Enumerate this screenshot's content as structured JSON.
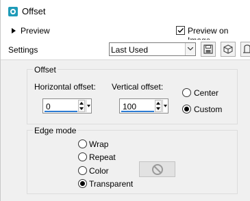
{
  "window": {
    "title": "Offset",
    "icon": "app-icon"
  },
  "preview": {
    "toggle_label": "Preview",
    "preview_on_image_label": "Preview on Image",
    "preview_on_image_checked": true
  },
  "settings": {
    "label": "Settings",
    "preset_value": "Last Used",
    "tools": [
      "save-preset-icon",
      "cube-icon",
      "dialog-icon"
    ]
  },
  "offset": {
    "group_label": "Offset",
    "horizontal_label": "Horizontal offset:",
    "horizontal_value": "0",
    "vertical_label": "Vertical offset:",
    "vertical_value": "100",
    "modes": [
      {
        "label": "Center",
        "checked": false
      },
      {
        "label": "Custom",
        "checked": true
      }
    ]
  },
  "edge_mode": {
    "group_label": "Edge mode",
    "options": [
      {
        "label": "Wrap",
        "checked": false
      },
      {
        "label": "Repeat",
        "checked": false
      },
      {
        "label": "Color",
        "checked": false
      },
      {
        "label": "Transparent",
        "checked": true
      }
    ],
    "color_swatch_icon": "no-color-icon"
  }
}
